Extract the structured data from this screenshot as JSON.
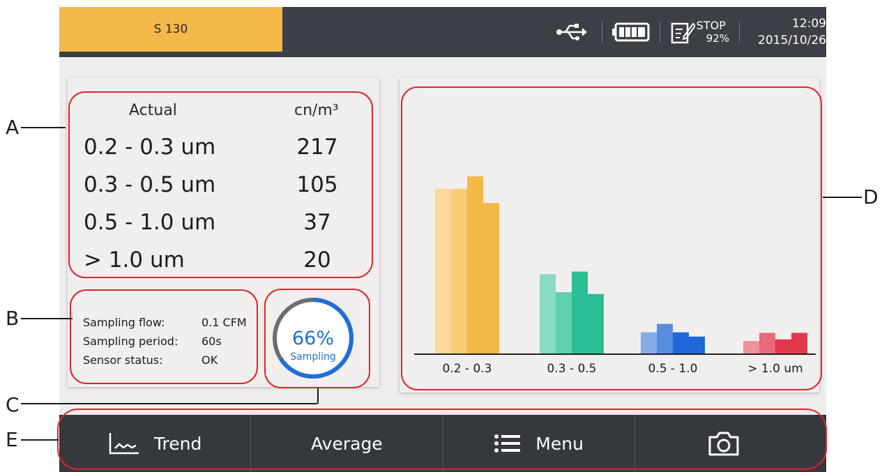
{
  "topbar": {
    "model_label": "S 130",
    "log_status": "STOP",
    "log_percent": "92%",
    "time": "12:09",
    "date": "2015/10/26"
  },
  "particles": {
    "header_left": "Actual",
    "header_right": "cn/m³",
    "rows": [
      {
        "size": "0.2 - 0.3 um",
        "count": "217"
      },
      {
        "size": "0.3 - 0.5 um",
        "count": "105"
      },
      {
        "size": "0.5 - 1.0 um",
        "count": "37"
      },
      {
        "size": "> 1.0 um",
        "count": "20"
      }
    ]
  },
  "sampling_info": {
    "flow_label": "Sampling flow:",
    "flow_value": "0.1 CFM",
    "period_label": "Sampling period:",
    "period_value": "60s",
    "sensor_label": "Sensor status:",
    "sensor_value": "OK"
  },
  "progress": {
    "percent_text": "66%",
    "percent_value": 66,
    "label": "Sampling"
  },
  "chart_data": {
    "type": "bar",
    "categories": [
      "0.2 - 0.3",
      "0.3 - 0.5",
      "0.5 - 1.0",
      "> 1.0 um"
    ],
    "values": [
      217,
      105,
      37,
      20
    ],
    "title": "",
    "xlabel": "",
    "ylabel": "",
    "colors": [
      "#f4b848",
      "#2bbd94",
      "#1f66d6",
      "#e0374a"
    ],
    "grid": false,
    "legend": "none"
  },
  "bottom_bar": {
    "trend_label": "Trend",
    "average_label": "Average",
    "menu_label": "Menu"
  },
  "annotations": [
    "A",
    "B",
    "C",
    "D",
    "E"
  ],
  "icons": {
    "usb": "usb-icon",
    "battery": "battery-icon",
    "log": "log-edit-icon",
    "trend": "trend-chart-icon",
    "menu": "list-menu-icon",
    "camera": "camera-icon"
  }
}
